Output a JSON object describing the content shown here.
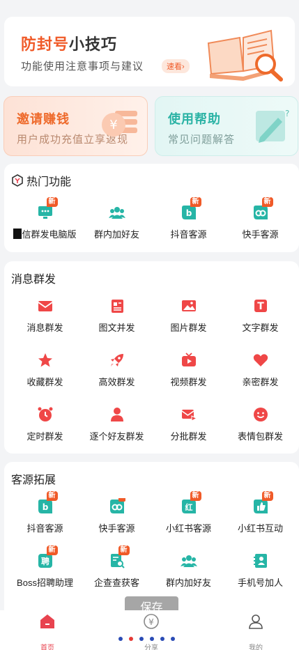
{
  "colors": {
    "accent_orange": "#f05a28",
    "accent_red": "#e8434f",
    "accent_teal": "#26b5a6"
  },
  "banner": {
    "title_highlight": "防封号",
    "title_rest": "小技巧",
    "subtitle": "功能使用注意事项与建议",
    "pill": "速看›",
    "art_icon": "open-book-magnifier-icon"
  },
  "cards": {
    "invite": {
      "title": "邀请赚钱",
      "subtitle": "用户成功充值立享返现",
      "icon": "yuan-coin-icon"
    },
    "help": {
      "title": "使用帮助",
      "subtitle": "常见问题解答",
      "icon": "question-pencil-icon"
    }
  },
  "hot": {
    "title": "热门功能",
    "items": [
      {
        "label": "信群发电脑版",
        "icon": "desktop-chat-icon",
        "badge": "新"
      },
      {
        "label": "群内加好友",
        "icon": "group-users-icon",
        "badge": ""
      },
      {
        "label": "抖音客源",
        "icon": "douyin-icon",
        "badge": "新"
      },
      {
        "label": "快手客源",
        "icon": "kuaishou-icon",
        "badge": "新"
      }
    ]
  },
  "messaging": {
    "title": "消息群发",
    "items": [
      {
        "label": "消息群发",
        "icon": "envelope-icon"
      },
      {
        "label": "图文并发",
        "icon": "image-text-icon"
      },
      {
        "label": "图片群发",
        "icon": "picture-icon"
      },
      {
        "label": "文字群发",
        "icon": "text-t-icon"
      },
      {
        "label": "收藏群发",
        "icon": "star-icon"
      },
      {
        "label": "高效群发",
        "icon": "rocket-icon"
      },
      {
        "label": "视频群发",
        "icon": "tv-play-icon"
      },
      {
        "label": "亲密群发",
        "icon": "heart-icon"
      },
      {
        "label": "定时群发",
        "icon": "alarm-clock-icon"
      },
      {
        "label": "逐个好友群发",
        "icon": "person-icon"
      },
      {
        "label": "分批群发",
        "icon": "batch-mail-icon"
      },
      {
        "label": "表情包群发",
        "icon": "smiley-icon"
      }
    ]
  },
  "sources": {
    "title": "客源拓展",
    "items": [
      {
        "label": "抖音客源",
        "icon": "douyin-icon",
        "badge": "新"
      },
      {
        "label": "快手客源",
        "icon": "kuaishou-icon",
        "badge": ""
      },
      {
        "label": "小红书客源",
        "icon": "xiaohongshu-icon",
        "badge": "新"
      },
      {
        "label": "小红书互动",
        "icon": "thumbs-up-icon",
        "badge": "新"
      },
      {
        "label": "Boss招聘助理",
        "icon": "boss-hire-icon",
        "badge": "新"
      },
      {
        "label": "企查查获客",
        "icon": "search-doc-icon",
        "badge": "新"
      },
      {
        "label": "群内加好友",
        "icon": "group-users-icon",
        "badge": ""
      },
      {
        "label": "手机号加人",
        "icon": "contact-book-icon",
        "badge": ""
      }
    ]
  },
  "overlay": {
    "save_label": "保存"
  },
  "tabbar": {
    "home": "首页",
    "share": "分享",
    "me": "我的"
  }
}
